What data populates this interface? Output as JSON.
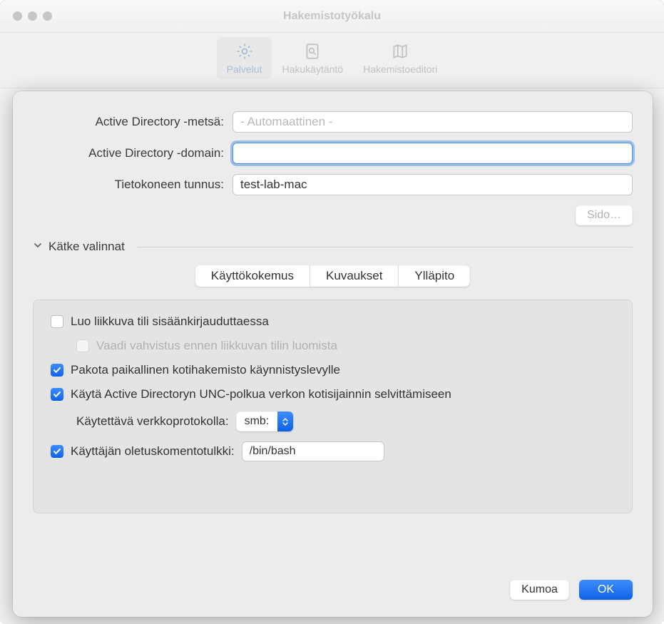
{
  "window": {
    "title": "Hakemistotyökalu"
  },
  "toolbar": {
    "services": "Palvelut",
    "search_policy": "Hakukäytäntö",
    "directory_editor": "Hakemistoeditori"
  },
  "form": {
    "forest_label": "Active Directory -metsä:",
    "forest_placeholder": "- Automaattinen -",
    "domain_label": "Active Directory -domain:",
    "domain_value": "",
    "computer_id_label": "Tietokoneen tunnus:",
    "computer_id_value": "test-lab-mac",
    "bind_button": "Sido…"
  },
  "disclosure": {
    "label": "Kätke valinnat"
  },
  "tabs": {
    "ux": "Käyttökokemus",
    "mappings": "Kuvaukset",
    "admin": "Ylläpito"
  },
  "options": {
    "create_mobile": "Luo liikkuva tili sisäänkirjauduttaessa",
    "require_confirm": "Vaadi vahvistus ennen liikkuvan tilin luomista",
    "force_local_home": "Pakota paikallinen kotihakemisto käynnistyslevylle",
    "use_unc": "Käytä Active Directoryn UNC-polkua verkon kotisijainnin selvittämiseen",
    "protocol_label": "Käytettävä verkkoprotokolla:",
    "protocol_value": "smb:",
    "default_shell_label": "Käyttäjän oletuskomentotulkki:",
    "default_shell_value": "/bin/bash"
  },
  "footer": {
    "cancel": "Kumoa",
    "ok": "OK"
  }
}
